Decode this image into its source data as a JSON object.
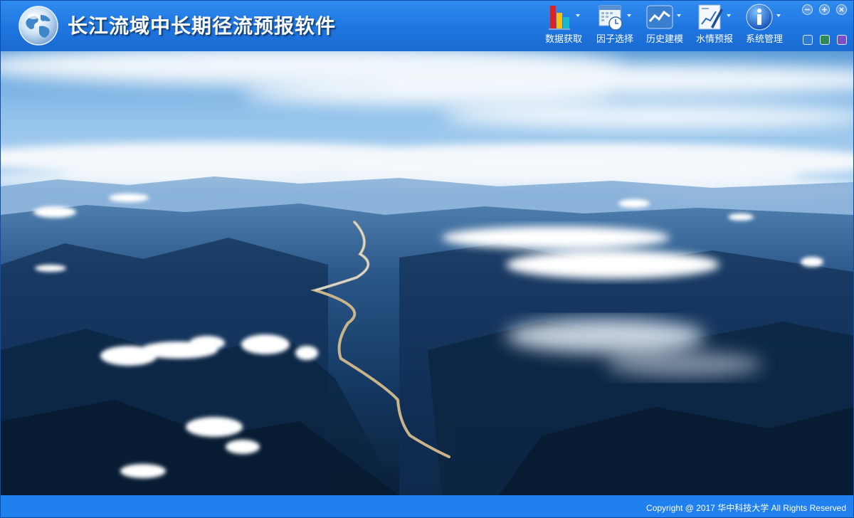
{
  "app": {
    "title": "长江流域中长期径流预报软件"
  },
  "toolbar": {
    "items": [
      {
        "label": "数据获取",
        "icon": "bar-chart-icon"
      },
      {
        "label": "因子选择",
        "icon": "calendar-clock-icon"
      },
      {
        "label": "历史建模",
        "icon": "line-trend-icon"
      },
      {
        "label": "水情预报",
        "icon": "chart-edit-icon"
      },
      {
        "label": "系统管理",
        "icon": "info-icon"
      }
    ]
  },
  "window_controls": [
    "minimize-icon",
    "maximize-icon",
    "close-icon"
  ],
  "theme_swatches": [
    "#2b7bd9",
    "#2e8b57",
    "#7a4fc9"
  ],
  "colors": {
    "titlebar": "#1f75df",
    "footer": "#1f80ee"
  },
  "footer": {
    "copyright": "Copyright @ 2017 华中科技大学 All Rights Reserved"
  }
}
